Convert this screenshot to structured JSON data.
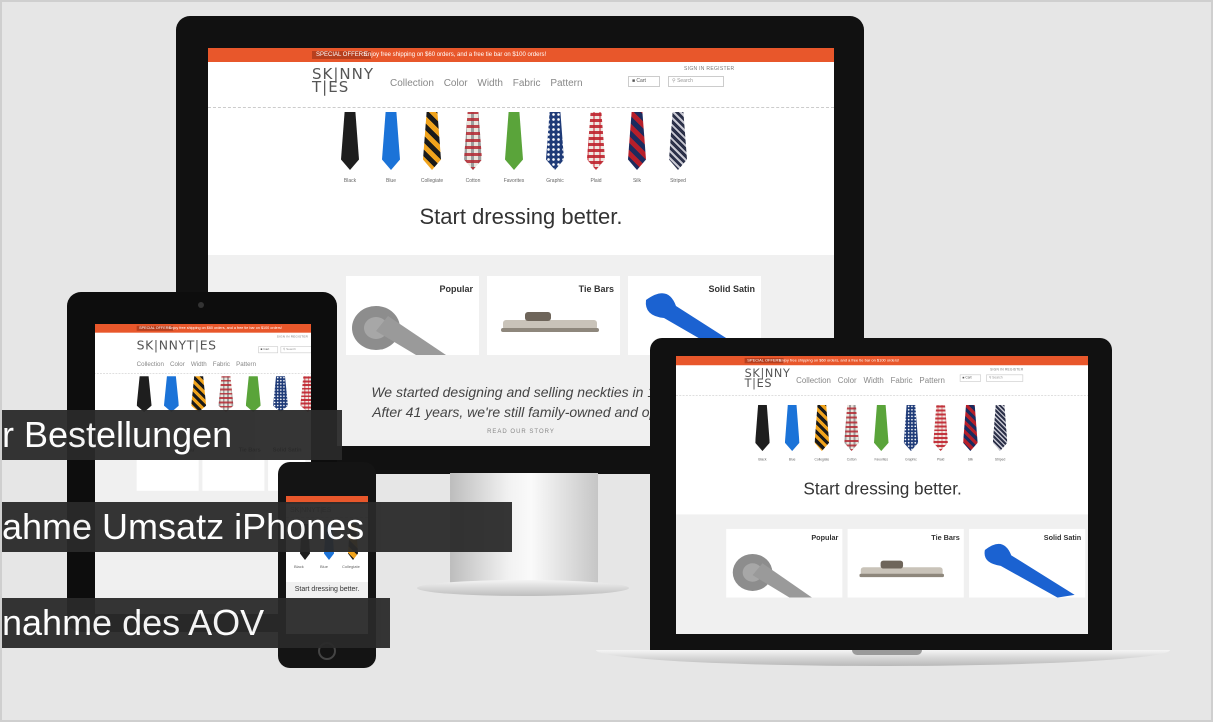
{
  "site": {
    "special_offers": "SPECIAL OFFERS",
    "shipping_banner": "Enjoy free shipping on $60 orders, and a free tie bar on $100 orders!",
    "account_links": "SIGN IN   REGISTER",
    "logo_line1": "SK|NNY",
    "logo_line2": "T|ES",
    "nav": [
      "Collection",
      "Color",
      "Width",
      "Fabric",
      "Pattern"
    ],
    "cart_label": "Cart",
    "search_placeholder": "Search",
    "ties": [
      "Black",
      "Blue",
      "Collegiate",
      "Cotton",
      "Favorites",
      "Graphic",
      "Plaid",
      "Silk",
      "Striped"
    ],
    "tagline": "Start dressing better.",
    "cards": [
      "Popular",
      "Tie Bars",
      "Solid Satin"
    ],
    "about_line1": "We started designing and selling neckties in 197",
    "about_line2": "After 41 years, we're still family-owned and oper",
    "about_link": "READ OUR STORY"
  },
  "captions": [
    "r Bestellungen",
    "ahme Umsatz iPhones",
    "nahme des AOV"
  ]
}
